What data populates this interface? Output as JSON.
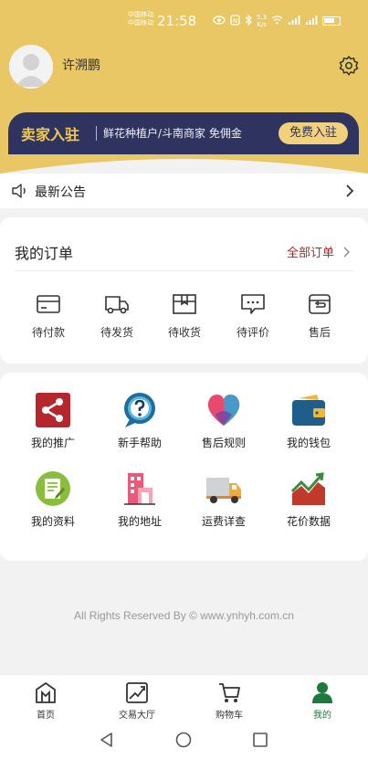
{
  "status_bar": {
    "carrier1": "中国移动",
    "carrier2": "中国移动",
    "time": "21:58",
    "speed_value": "5.3",
    "speed_unit": "K/s"
  },
  "profile": {
    "username": "许溯鹏"
  },
  "banner": {
    "title": "卖家入驻",
    "subtitle": "鲜花种植户/斗南商家 免佣金",
    "button": "免费入驻"
  },
  "notice": {
    "label": "最新公告"
  },
  "orders": {
    "title": "我的订单",
    "all_link": "全部订单",
    "items": [
      {
        "label": "待付款",
        "icon": "wallet-card-icon"
      },
      {
        "label": "待发货",
        "icon": "truck-icon"
      },
      {
        "label": "待收货",
        "icon": "box-icon"
      },
      {
        "label": "待评价",
        "icon": "comment-icon"
      },
      {
        "label": "售后",
        "icon": "return-icon"
      }
    ]
  },
  "services": {
    "items": [
      {
        "label": "我的推广",
        "icon": "share-icon",
        "color": "#b5262d"
      },
      {
        "label": "新手帮助",
        "icon": "help-icon",
        "color": "#1c6e9e"
      },
      {
        "label": "售后规则",
        "icon": "heart-icon",
        "color": "#e84a6f"
      },
      {
        "label": "我的钱包",
        "icon": "wallet-icon",
        "color": "#1f5d8a"
      },
      {
        "label": "我的资料",
        "icon": "document-icon",
        "color": "#8bbd3c"
      },
      {
        "label": "我的地址",
        "icon": "building-icon",
        "color": "#e85a7a"
      },
      {
        "label": "运费详查",
        "icon": "delivery-truck-icon",
        "color": "#e8842a"
      },
      {
        "label": "花价数据",
        "icon": "chart-icon",
        "color": "#c0392b"
      }
    ]
  },
  "footer": {
    "copyright": "All Rights Reserved By © www.ynhyh.com.cn"
  },
  "tabbar": {
    "items": [
      {
        "label": "首页",
        "icon": "home-icon"
      },
      {
        "label": "交易大厅",
        "icon": "trade-hall-icon"
      },
      {
        "label": "购物车",
        "icon": "cart-icon"
      },
      {
        "label": "我的",
        "icon": "user-icon",
        "active": true
      }
    ],
    "active_color": "#1e7a3a"
  },
  "colors": {
    "header_bg": "#e8c764",
    "banner_bg": "#2e335f",
    "banner_title": "#f2c94c",
    "link_red": "#a52a2a"
  }
}
